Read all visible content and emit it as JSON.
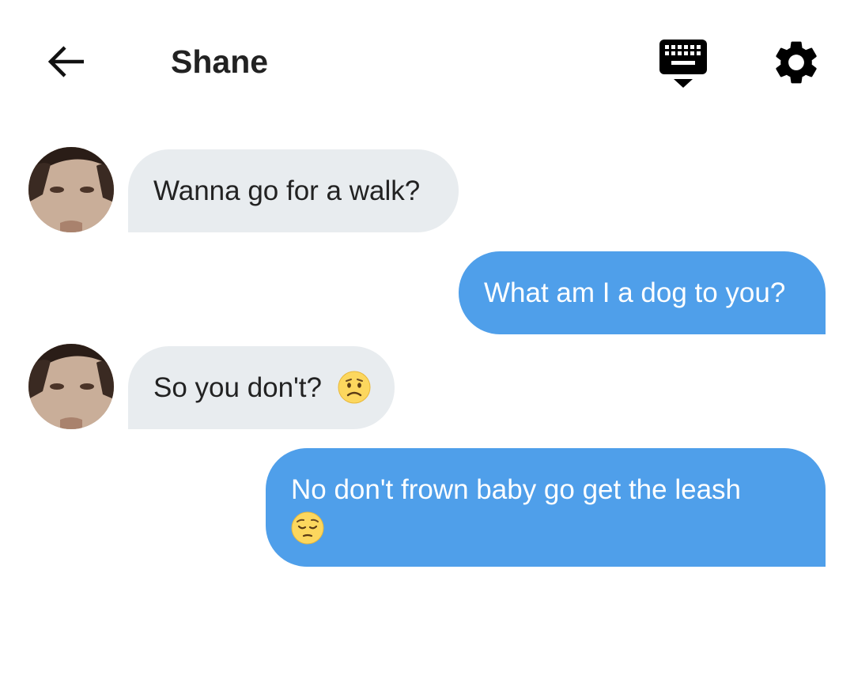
{
  "header": {
    "title": "Shane"
  },
  "messages": [
    {
      "direction": "incoming",
      "text": "Wanna go for a walk?"
    },
    {
      "direction": "outgoing",
      "text": "What am I a dog to you?"
    },
    {
      "direction": "incoming",
      "text": "So you don't?"
    },
    {
      "direction": "outgoing",
      "text": "No don't frown baby go get the leash"
    }
  ],
  "emojis": {
    "msg3": "worried-face-emoji",
    "msg4": "pensive-face-emoji"
  },
  "colors": {
    "incoming_bubble": "#e8ecef",
    "outgoing_bubble": "#4f9fea",
    "text_dark": "#222222"
  },
  "icons": [
    "back-arrow-icon",
    "keyboard-hide-icon",
    "gear-icon"
  ]
}
